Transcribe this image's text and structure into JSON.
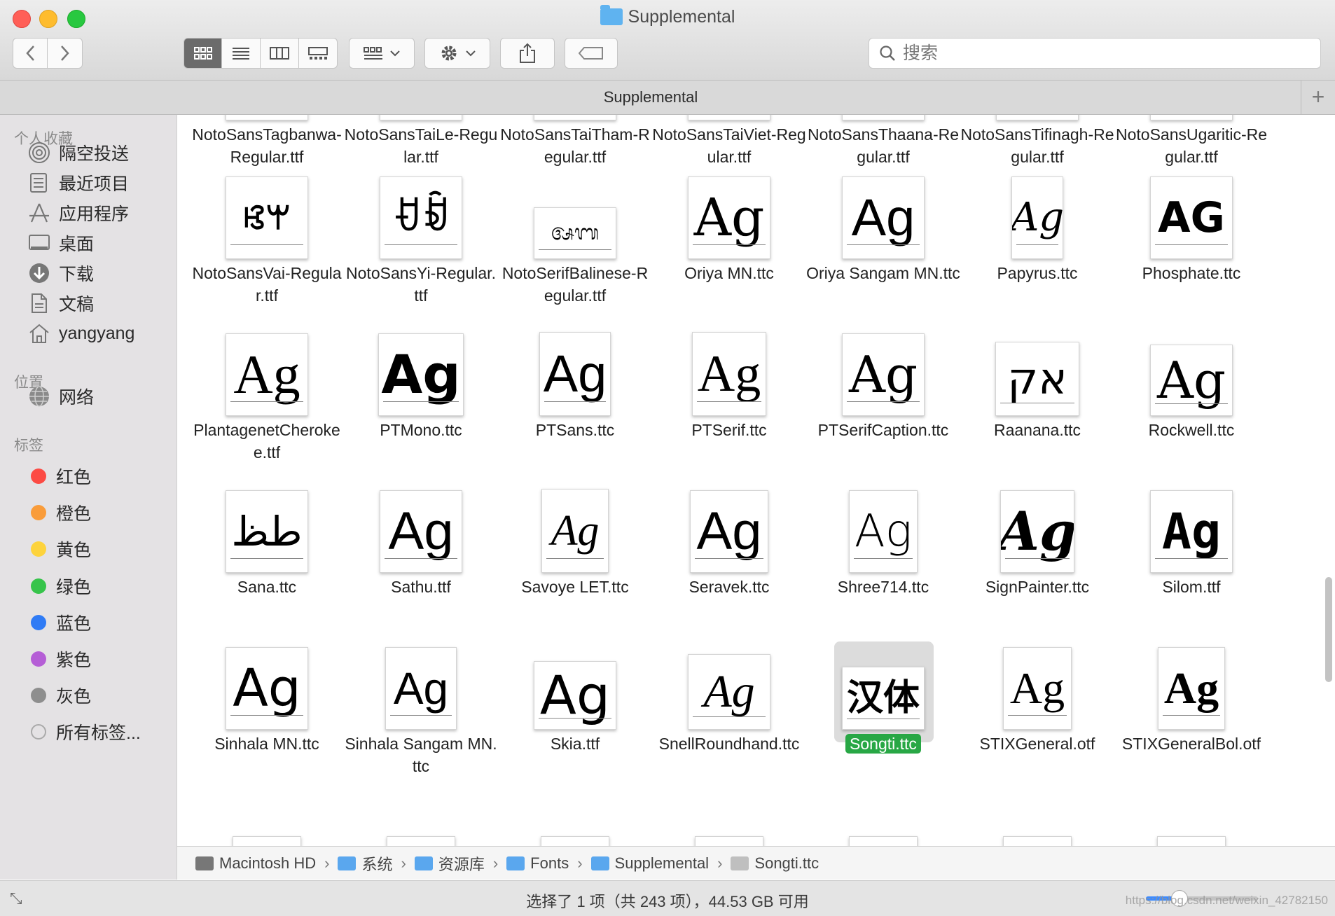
{
  "window": {
    "title": "Supplemental"
  },
  "toolbar": {
    "back_icon": "chevron-left",
    "forward_icon": "chevron-right",
    "search_placeholder": "搜索"
  },
  "tabbar": {
    "tab_label": "Supplemental",
    "plus_label": "+"
  },
  "sidebar": {
    "favorites_header": "个人收藏",
    "favorites": [
      {
        "label": "隔空投送",
        "icon": "airdrop-icon"
      },
      {
        "label": "最近项目",
        "icon": "recents-icon"
      },
      {
        "label": "应用程序",
        "icon": "applications-icon"
      },
      {
        "label": "桌面",
        "icon": "desktop-icon"
      },
      {
        "label": "下载",
        "icon": "downloads-icon"
      },
      {
        "label": "文稿",
        "icon": "documents-icon"
      },
      {
        "label": "yangyang",
        "icon": "home-icon"
      }
    ],
    "locations_header": "位置",
    "locations": [
      {
        "label": "网络",
        "icon": "network-icon"
      }
    ],
    "tags_header": "标签",
    "tags": [
      {
        "label": "红色",
        "color": "#fc4b44"
      },
      {
        "label": "橙色",
        "color": "#f99c3a"
      },
      {
        "label": "黄色",
        "color": "#fdd33c"
      },
      {
        "label": "绿色",
        "color": "#37c44b"
      },
      {
        "label": "蓝色",
        "color": "#2f7bf5"
      },
      {
        "label": "紫色",
        "color": "#b55ed6"
      },
      {
        "label": "灰色",
        "color": "#8e8e8e"
      }
    ],
    "all_tags": "所有标签..."
  },
  "files": [
    {
      "name": "NotoSansTagbanwa-Regular.ttf",
      "glyph": ""
    },
    {
      "name": "NotoSansTaiLe-Regular.ttf",
      "glyph": ""
    },
    {
      "name": "NotoSansTaiTham-Regular.ttf",
      "glyph": ""
    },
    {
      "name": "NotoSansTaiViet-Regular.ttf",
      "glyph": ""
    },
    {
      "name": "NotoSansThaana-Regular.ttf",
      "glyph": ""
    },
    {
      "name": "NotoSansTifinagh-Regular.ttf",
      "glyph": ""
    },
    {
      "name": "NotoSansUgaritic-Regular.ttf",
      "glyph": ""
    },
    {
      "name": "NotoSansVai-Regular.ttf",
      "glyph": "ꕙꕚ"
    },
    {
      "name": "NotoSansYi-Regular.ttf",
      "glyph": "ꀀꀁ"
    },
    {
      "name": "NotoSerifBalinese-Regular.ttf",
      "glyph": "ᬅᬩ"
    },
    {
      "name": "Oriya MN.ttc",
      "glyph": "Ag"
    },
    {
      "name": "Oriya Sangam MN.ttc",
      "glyph": "Ag"
    },
    {
      "name": "Papyrus.ttc",
      "glyph": "Ag"
    },
    {
      "name": "Phosphate.ttc",
      "glyph": "AG"
    },
    {
      "name": "PlantagenetCherokee.ttf",
      "glyph": "Ag"
    },
    {
      "name": "PTMono.ttc",
      "glyph": "Ag"
    },
    {
      "name": "PTSans.ttc",
      "glyph": "Ag"
    },
    {
      "name": "PTSerif.ttc",
      "glyph": "Ag"
    },
    {
      "name": "PTSerifCaption.ttc",
      "glyph": "Ag"
    },
    {
      "name": "Raanana.ttc",
      "glyph": "אק"
    },
    {
      "name": "Rockwell.ttc",
      "glyph": "Ag"
    },
    {
      "name": "Sana.ttc",
      "glyph": "ﻃﻆ"
    },
    {
      "name": "Sathu.ttf",
      "glyph": "Ag"
    },
    {
      "name": "Savoye LET.ttc",
      "glyph": "Ag"
    },
    {
      "name": "Seravek.ttc",
      "glyph": "Ag"
    },
    {
      "name": "Shree714.ttc",
      "glyph": "Ag"
    },
    {
      "name": "SignPainter.ttc",
      "glyph": "Ag"
    },
    {
      "name": "Silom.ttf",
      "glyph": "Ag"
    },
    {
      "name": "Sinhala MN.ttc",
      "glyph": "Ag"
    },
    {
      "name": "Sinhala Sangam MN.ttc",
      "glyph": "Ag"
    },
    {
      "name": "Skia.ttf",
      "glyph": "Ag"
    },
    {
      "name": "SnellRoundhand.ttc",
      "glyph": "Ag"
    },
    {
      "name": "Songti.ttc",
      "glyph": "汉体",
      "selected": true
    },
    {
      "name": "STIXGeneral.otf",
      "glyph": "Ag"
    },
    {
      "name": "STIXGeneralBol.otf",
      "glyph": "Ag"
    }
  ],
  "pathbar": {
    "items": [
      {
        "label": "Macintosh HD",
        "color": "#777777"
      },
      {
        "label": "系统",
        "color": "#5aa7ee"
      },
      {
        "label": "资源库",
        "color": "#5aa7ee"
      },
      {
        "label": "Fonts",
        "color": "#5aa7ee"
      },
      {
        "label": "Supplemental",
        "color": "#5aa7ee"
      },
      {
        "label": "Songti.ttc",
        "color": "#bfbfbf"
      }
    ],
    "separator": "›"
  },
  "statusbar": {
    "text": "选择了 1 项（共 243 项），44.53 GB 可用",
    "watermark": "https://blog.csdn.net/weixin_42782150"
  }
}
